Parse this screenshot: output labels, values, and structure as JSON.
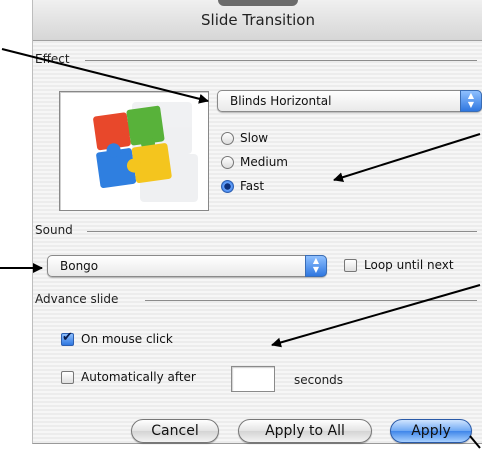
{
  "window": {
    "title": "Slide Transition"
  },
  "effect": {
    "label": "Effect",
    "selected": "Blinds Horizontal",
    "preview_icon": "puzzle-pieces-icon",
    "speeds": [
      {
        "label": "Slow",
        "selected": false
      },
      {
        "label": "Medium",
        "selected": false
      },
      {
        "label": "Fast",
        "selected": true
      }
    ]
  },
  "sound": {
    "label": "Sound",
    "selected": "Bongo",
    "loop_label": "Loop until next",
    "loop_checked": false
  },
  "advance": {
    "label": "Advance slide",
    "mouse_click_label": "On mouse click",
    "mouse_click_checked": true,
    "auto_label": "Automatically after",
    "auto_checked": false,
    "seconds_value": "",
    "seconds_label": "seconds"
  },
  "buttons": {
    "cancel": "Cancel",
    "apply_all": "Apply to All",
    "apply": "Apply"
  },
  "colors": {
    "accent": "#2f77e0",
    "annotation_arrow": "#000000"
  }
}
